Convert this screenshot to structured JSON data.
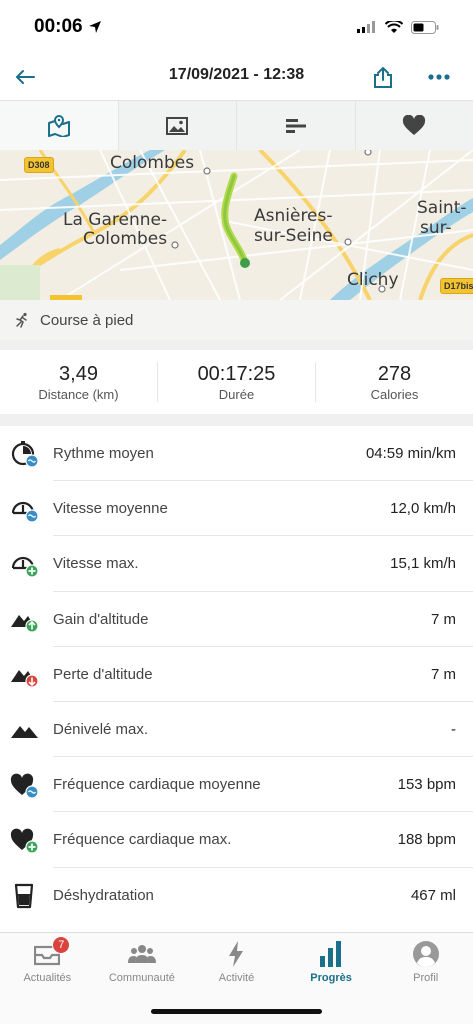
{
  "status_bar": {
    "time": "00:06"
  },
  "header": {
    "title": "17/09/2021 - 12:38"
  },
  "map": {
    "labels": {
      "colombes": "Colombes",
      "la_garenne": "La Garenne-",
      "la_garenne_2": "Colombes",
      "asnieres": "Asnières-",
      "asnieres_2": "sur-Seine",
      "saint": "Saint-",
      "saint_2": "sur-",
      "clichy": "Clichy"
    },
    "road_badges": {
      "d308": "D308",
      "d17bis": "D17bis"
    }
  },
  "activity": {
    "type": "Course à pied"
  },
  "summary": [
    {
      "value": "3,49",
      "label": "Distance (km)"
    },
    {
      "value": "00:17:25",
      "label": "Durée"
    },
    {
      "value": "278",
      "label": "Calories"
    }
  ],
  "stats": [
    {
      "label": "Rythme moyen",
      "value": "04:59 min/km",
      "icon": "stopwatch-avg-icon"
    },
    {
      "label": "Vitesse moyenne",
      "value": "12,0 km/h",
      "icon": "speedometer-avg-icon"
    },
    {
      "label": "Vitesse max.",
      "value": "15,1 km/h",
      "icon": "speedometer-max-icon"
    },
    {
      "label": "Gain d'altitude",
      "value": "7 m",
      "icon": "altitude-gain-icon"
    },
    {
      "label": "Perte d'altitude",
      "value": "7 m",
      "icon": "altitude-loss-icon"
    },
    {
      "label": "Dénivelé max.",
      "value": "-",
      "icon": "mountain-icon"
    },
    {
      "label": "Fréquence cardiaque moyenne",
      "value": "153 bpm",
      "icon": "heart-avg-icon"
    },
    {
      "label": "Fréquence cardiaque max.",
      "value": "188 bpm",
      "icon": "heart-max-icon"
    },
    {
      "label": "Déshydratation",
      "value": "467 ml",
      "icon": "glass-icon"
    }
  ],
  "nav": {
    "items": [
      {
        "label": "Actualités",
        "badge": "7"
      },
      {
        "label": "Communauté"
      },
      {
        "label": "Activité"
      },
      {
        "label": "Progrès"
      },
      {
        "label": "Profil"
      }
    ]
  },
  "colors": {
    "accent": "#1b6f8a",
    "badge": "#d9443e",
    "route": "#8bc34a"
  }
}
